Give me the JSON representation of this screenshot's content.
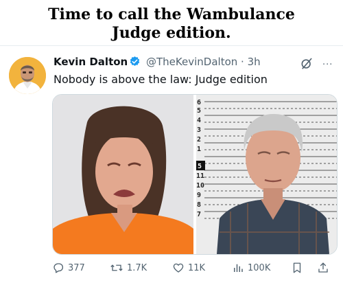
{
  "meme": {
    "title_line1": "Time to call the Wambulance",
    "title_line2": "Judge edition."
  },
  "tweet": {
    "author_name": "Kevin Dalton",
    "handle": "@TheKevinDalton",
    "separator": "·",
    "time": "3h",
    "text": "Nobody is above the law: Judge edition",
    "verified": true,
    "more_label": "···"
  },
  "mugshot_ruler": {
    "numbers": [
      "6",
      "5",
      "4",
      "3",
      "2",
      "1",
      "5",
      "11",
      "10",
      "9",
      "8",
      "7"
    ]
  },
  "stats": {
    "replies": "377",
    "reposts": "1.7K",
    "likes": "11K",
    "views": "100K"
  },
  "icons": {
    "verified": "verified-badge-icon",
    "grok": "grok-icon",
    "more": "more-icon",
    "reply": "reply-icon",
    "repost": "repost-icon",
    "like": "heart-icon",
    "views": "views-icon",
    "bookmark": "bookmark-icon",
    "share": "share-icon"
  },
  "colors": {
    "verified_blue": "#1d9bf0",
    "muted_gray": "#536471",
    "avatar_bg": "#f2b33d",
    "jumpsuit_orange": "#f47a1f"
  }
}
